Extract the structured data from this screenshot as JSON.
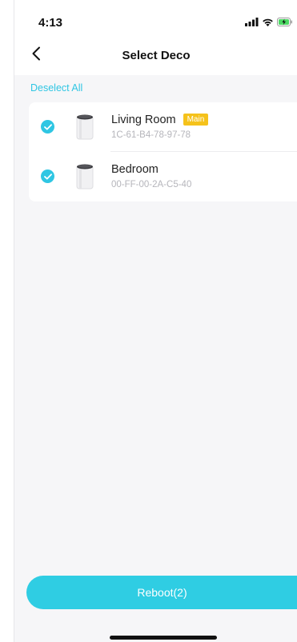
{
  "status_bar": {
    "time": "4:13",
    "icons": [
      "signal-icon",
      "wifi-icon",
      "battery-charging-icon"
    ]
  },
  "header": {
    "title": "Select Deco",
    "back_icon": "chevron-left-icon"
  },
  "deselect_all_label": "Deselect All",
  "devices": [
    {
      "name": "Living Room",
      "badge": "Main",
      "mac": "1C-61-B4-78-97-78",
      "selected": true,
      "icon": "deco-device-icon"
    },
    {
      "name": "Bedroom",
      "mac": "00-FF-00-2A-C5-40",
      "selected": true,
      "icon": "deco-device-icon"
    }
  ],
  "reboot_button_label": "Reboot(2)",
  "colors": {
    "accent": "#2fc6e3",
    "button": "#2fcde3",
    "badge": "#f5c21b",
    "background": "#f6f6f8"
  }
}
